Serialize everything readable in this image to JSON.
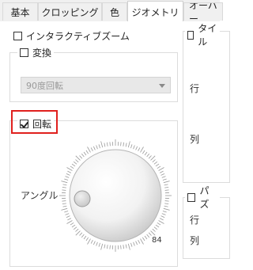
{
  "tabs": [
    {
      "label": "基本",
      "active": false
    },
    {
      "label": "クロッピング",
      "active": false
    },
    {
      "label": "色",
      "active": false
    },
    {
      "label": "ジオメトリ",
      "active": true
    },
    {
      "label": "オーバー",
      "active": false
    }
  ],
  "interactive_zoom": {
    "label": "インタラクティブズーム",
    "checked": false
  },
  "transform": {
    "label": "変換",
    "checked": false
  },
  "transform_select": {
    "value": "90度回転"
  },
  "rotation": {
    "label": "回転",
    "checked": true
  },
  "angle": {
    "label": "アングル",
    "value": "84"
  },
  "tile": {
    "label": "タイル",
    "checked": false,
    "row_label": "行",
    "col_label": "列"
  },
  "puzzle": {
    "label": "パズ",
    "checked": false,
    "row_label": "行",
    "col_label": "列"
  },
  "colors": {
    "highlight": "#e0201e",
    "disabled_select": "#e8e8e8"
  }
}
